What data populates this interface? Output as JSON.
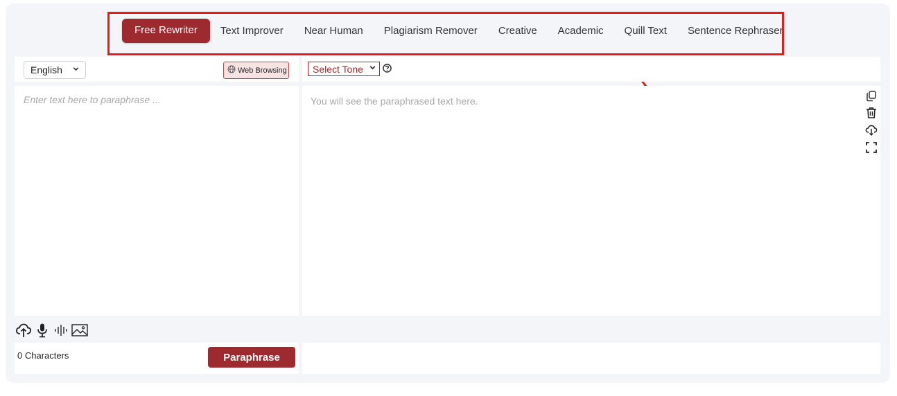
{
  "tabs": [
    {
      "label": "Free Rewriter",
      "active": true
    },
    {
      "label": "Text Improver",
      "active": false
    },
    {
      "label": "Near Human",
      "active": false
    },
    {
      "label": "Plagiarism Remover",
      "active": false
    },
    {
      "label": "Creative",
      "active": false
    },
    {
      "label": "Academic",
      "active": false
    },
    {
      "label": "Quill Text",
      "active": false
    },
    {
      "label": "Sentence Rephraser",
      "active": false
    }
  ],
  "input": {
    "language": "English",
    "web_browsing_label": "Web Browsing",
    "placeholder": "Enter text here to paraphrase ...",
    "char_count": "0 Characters",
    "paraphrase_label": "Paraphrase",
    "tool_icons": [
      "upload-cloud-icon",
      "microphone-icon",
      "audio-wave-icon",
      "image-icon"
    ]
  },
  "output": {
    "tone_select": "Select Tone",
    "placeholder": "You will see the paraphrased text here.",
    "action_icons": [
      "copy-icon",
      "trash-icon",
      "download-icon",
      "fullscreen-icon"
    ]
  },
  "colors": {
    "brand": "#9c2a2f",
    "highlight_annotation": "#e81a1a",
    "background": "#f3f5f9"
  }
}
